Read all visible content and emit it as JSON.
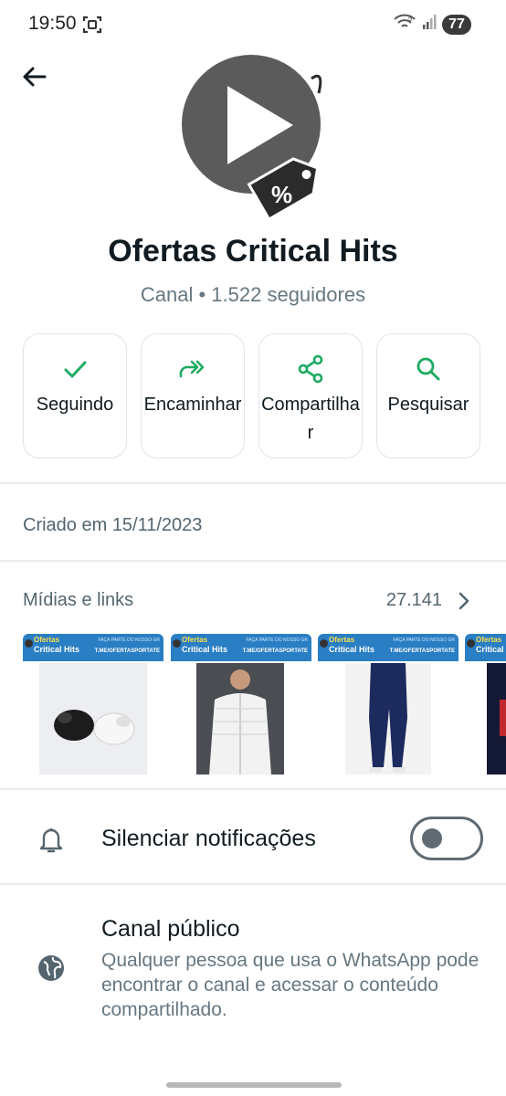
{
  "status_bar": {
    "time": "19:50",
    "battery": "77"
  },
  "channel": {
    "name": "Ofertas Critical Hits",
    "meta": "Canal • 1.522 seguidores",
    "avatar_badge": "%"
  },
  "actions": [
    {
      "label": "Seguindo",
      "icon": "check-icon"
    },
    {
      "label": "Encaminhar",
      "icon": "forward-icon"
    },
    {
      "label": "Compartilhar",
      "icon": "share-icon"
    },
    {
      "label": "Pesquisar",
      "icon": "search-icon"
    }
  ],
  "created": "Criado em 15/11/2023",
  "media": {
    "title": "Mídias e links",
    "count": "27.141",
    "thumbs": [
      {
        "banner_title_top": "Ofertas",
        "banner_title": "Critical Hits",
        "banner_small": "FAÇA PARTE DO NOSSO GR",
        "banner_link": "T.ME/OFERTASPORTATE",
        "subject": "earbuds"
      },
      {
        "banner_title_top": "Ofertas",
        "banner_title": "Critical Hits",
        "banner_small": "FAÇA PARTE DO NOSSO GR",
        "banner_link": "T.ME/OFERTASPORTATE",
        "subject": "white jacket"
      },
      {
        "banner_title_top": "Ofertas",
        "banner_title": "Critical Hits",
        "banner_small": "FAÇA PARTE DO NOSSO GR",
        "banner_link": "T.ME/OFERTASPORTATE",
        "subject": "navy pants"
      },
      {
        "banner_title_top": "Ofertas",
        "banner_title": "Critical Hits",
        "banner_small": "",
        "banner_link": "",
        "subject": "partial"
      }
    ]
  },
  "mute": {
    "label": "Silenciar notificações",
    "enabled": false
  },
  "public_channel": {
    "title": "Canal público",
    "description": "Qualquer pessoa que usa o WhatsApp pode encontrar o canal e acessar o conteúdo compartilhado."
  },
  "colors": {
    "accent": "#1daa61",
    "text": "#111b21",
    "secondary": "#667781",
    "banner": "#2a7ec4"
  }
}
